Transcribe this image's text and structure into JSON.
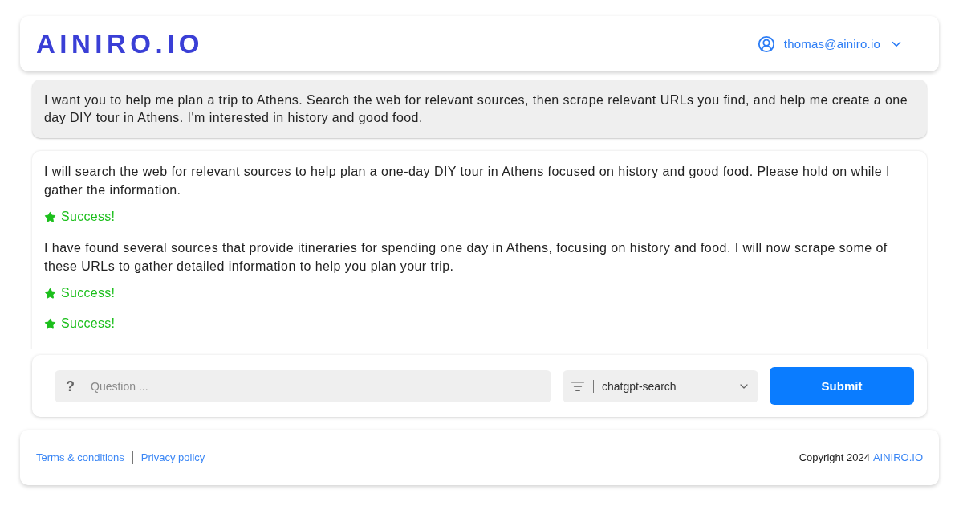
{
  "header": {
    "logo": "AINIRO.IO",
    "user": {
      "email": "thomas@ainiro.io"
    }
  },
  "conversation": [
    {
      "kind": "user_message",
      "text": "I want you to help me plan a trip to Athens. Search the web for relevant sources, then scrape relevant URLs you find, and help me create a one day DIY tour in Athens. I'm interested in history and good food."
    },
    {
      "kind": "assistant_message",
      "parts": [
        {
          "kind": "text",
          "text": "I will search the web for relevant sources to help plan a one-day DIY tour in Athens focused on history and good food. Please hold on while I gather the information."
        },
        {
          "kind": "status",
          "text": "Success!"
        },
        {
          "kind": "text",
          "text": "I have found several sources that provide itineraries for spending one day in Athens, focusing on history and food. I will now scrape some of these URLs to gather detailed information to help you plan your trip."
        },
        {
          "kind": "status",
          "text": "Success!"
        },
        {
          "kind": "status",
          "text": "Success!"
        }
      ]
    }
  ],
  "composer": {
    "question": {
      "icon_text": "?",
      "placeholder": "Question ..."
    },
    "type_select": {
      "value": "chatgpt-search"
    },
    "submit": "Submit"
  },
  "footer": {
    "links": [
      "Terms & conditions",
      "Privacy policy"
    ],
    "copyright": "Copyright 2024",
    "brand_link": "AINIRO.IO"
  }
}
